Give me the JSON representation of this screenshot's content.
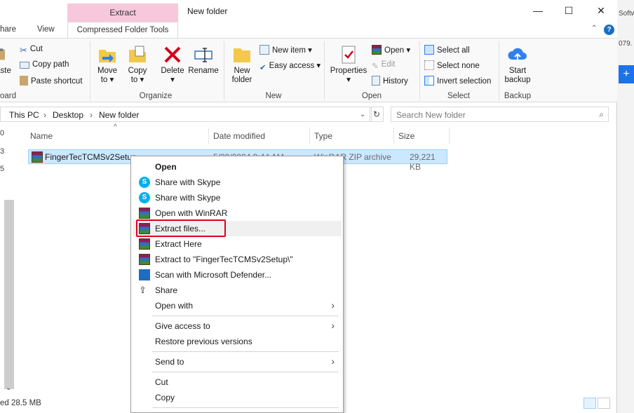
{
  "window": {
    "title": "New folder",
    "context_tab_group": "Extract",
    "tabs": [
      "hare",
      "View",
      "Compressed Folder Tools"
    ],
    "minimize": "—",
    "maximize": "☐",
    "close": "✕",
    "help": "?"
  },
  "ribbon": {
    "clipboard": {
      "cut": "Cut",
      "copy_path": "Copy path",
      "paste_shortcut": "Paste shortcut",
      "paste_partial": "aste",
      "group_partial": "oard"
    },
    "organize": {
      "move_to_1": "Move",
      "move_to_2": "to ▾",
      "copy_to_1": "Copy",
      "copy_to_2": "to ▾",
      "delete": "Delete",
      "delete_arrow": "▾",
      "rename": "Rename",
      "group": "Organize"
    },
    "new": {
      "new_folder_1": "New",
      "new_folder_2": "folder",
      "new_item": "New item ▾",
      "easy_access": "Easy access ▾",
      "group": "New"
    },
    "open": {
      "properties": "Properties",
      "properties_arrow": "▾",
      "open": "Open ▾",
      "edit": "Edit",
      "history": "History",
      "group": "Open"
    },
    "select": {
      "select_all": "Select all",
      "select_none": "Select none",
      "invert_selection": "Invert selection",
      "group": "Select"
    },
    "backup": {
      "start_backup_1": "Start",
      "start_backup_2": "backup",
      "group": "Backup"
    }
  },
  "address": {
    "crumbs": [
      "This PC",
      "Desktop",
      "New folder"
    ],
    "separator": "›",
    "search_placeholder": "Search New folder"
  },
  "columns": {
    "name": "Name",
    "date_modified": "Date modified",
    "type": "Type",
    "size": "Size"
  },
  "file": {
    "name": "FingerTecTCMSv2Setup",
    "date": "5/29/2024 9:44 AM",
    "type": "WinRAR ZIP archive",
    "size": "29,221 KB"
  },
  "status": {
    "text": "ed  28.5 MB"
  },
  "edge": {
    "top_text": "Softw",
    "num_text": "079.",
    "plus": "+"
  },
  "left_labels": [
    "0",
    "3",
    "5"
  ],
  "context_menu": {
    "items": [
      {
        "label": "Open",
        "icon": "none"
      },
      {
        "label": "Share with Skype",
        "icon": "skype-icon"
      },
      {
        "label": "Share with Skype",
        "icon": "skype-icon"
      },
      {
        "label": "Open with WinRAR",
        "icon": "winrar-icon"
      },
      {
        "label": "Extract files...",
        "icon": "winrar-icon"
      },
      {
        "label": "Extract Here",
        "icon": "winrar-icon"
      },
      {
        "label": "Extract to \"FingerTecTCMSv2Setup\\\"",
        "icon": "winrar-icon"
      },
      {
        "label": "Scan with Microsoft Defender...",
        "icon": "defender-icon"
      },
      {
        "label": "Share",
        "icon": "share-icon"
      },
      {
        "label": "Open with",
        "icon": "none"
      },
      {
        "label": "Give access to",
        "icon": "none"
      },
      {
        "label": "Restore previous versions",
        "icon": "none"
      },
      {
        "label": "Send to",
        "icon": "none"
      },
      {
        "label": "Cut",
        "icon": "none"
      },
      {
        "label": "Copy",
        "icon": "none"
      }
    ],
    "submenu_arrow": "›"
  }
}
